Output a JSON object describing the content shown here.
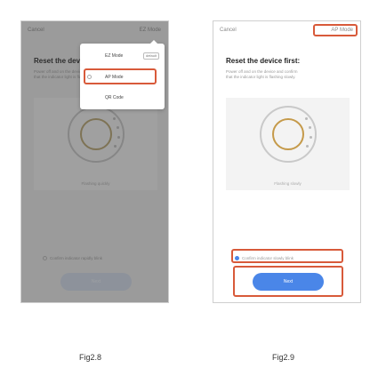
{
  "fig_a": {
    "caption": "Fig2.8",
    "topbar": {
      "cancel": "Cancel",
      "mode": "EZ Mode"
    },
    "title": "Reset the device first:",
    "desc": [
      "Power off and on the device and confirm",
      "that the indicator light is flashing."
    ],
    "mode_menu": {
      "items": [
        {
          "label": "EZ Mode",
          "badge": "default"
        },
        {
          "label": "AP Mode"
        },
        {
          "label": "QR Code"
        }
      ]
    },
    "illustration_caption": "Flashing quickly",
    "confirm_text": "Confirm indicator rapidly blink",
    "next_label": "Next"
  },
  "fig_b": {
    "caption": "Fig2.9",
    "topbar": {
      "cancel": "Cancel",
      "mode": "AP Mode"
    },
    "title": "Reset the device first:",
    "desc": [
      "Power off and on the device and confirm",
      "that the indicator light is flashing slowly."
    ],
    "illustration_caption": "Flashing slowly",
    "confirm_text": "Confirm indicator slowly blink",
    "next_label": "Next"
  }
}
